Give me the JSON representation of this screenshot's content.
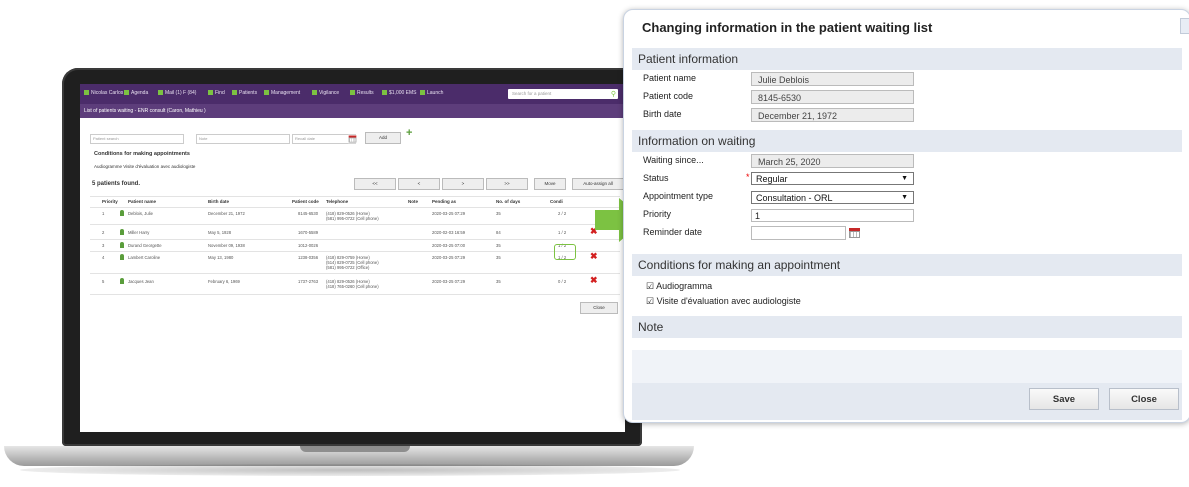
{
  "laptop": {
    "nav": [
      "Nicolas Carlos",
      "Agenda",
      "Mail (1) F (84)",
      "Find",
      "Patients",
      "Management",
      "Vigilance",
      "Results",
      "$1,000 EMS",
      "Launch"
    ],
    "search_placeholder": "Search for a patient",
    "subtitle": "List of patients waiting - ENR consult (Caron, Mathieu )",
    "filters": {
      "patient_search": "Patient search",
      "note": "Note",
      "recall_date": "Recall date",
      "add_label": "Add"
    },
    "conditions_title": "Conditions for making appointments",
    "condition_options": "Audiogramme  Visite d'évaluation avec audiologiste",
    "found_text": "5 patients found.",
    "pager": [
      "<<",
      "<",
      ">",
      ">>"
    ],
    "move_label": "Move",
    "auto_assign_label": "Auto-assign all",
    "close_label": "Close",
    "columns": [
      "Priority",
      "Patient name",
      "Birth date",
      "Patient code",
      "Telephone",
      "Note",
      "Pending as",
      "No. of days",
      "Condi"
    ],
    "rows": [
      {
        "priority": "1",
        "name": "Deblois, Julie",
        "birth": "December 21, 1972",
        "code": "8145-6530",
        "tel": "(418) 829-0526 (Home)\n(581) 995-0722 (Cell phone)",
        "pending": "2020-03-25 07:29",
        "days": "35",
        "cond": "2 / 2"
      },
      {
        "priority": "2",
        "name": "Miller Harry",
        "birth": "May 5, 1928",
        "code": "1670-5589",
        "tel": "",
        "pending": "2020-02-03 16:59",
        "days": "84",
        "cond": "1 / 2"
      },
      {
        "priority": "3",
        "name": "Durand Georgette",
        "birth": "November 09, 1938",
        "code": "1012-0026",
        "tel": "",
        "pending": "2020-03-25 07:00",
        "days": "35",
        "cond": "1 / 2"
      },
      {
        "priority": "4",
        "name": "Lambert Caroline",
        "birth": "May 13, 1980",
        "code": "1238-0356",
        "tel": "(418) 829-0759 (Home)\n(514) 829-0725 (Cell phone)\n(581) 995-0722 (Office)",
        "pending": "2020-03-25 07:29",
        "days": "35",
        "cond": "1 / 2"
      },
      {
        "priority": "5",
        "name": "Jacques Jean",
        "birth": "February 6, 1969",
        "code": "1737-2763",
        "tel": "(418) 829-0526 (Home)\n(418) 765-0260 (Cell phone)",
        "pending": "2020-03-25 07:29",
        "days": "35",
        "cond": "0 / 2"
      }
    ]
  },
  "dialog": {
    "title": "Changing information in the patient waiting list",
    "patient_info_title": "Patient information",
    "patient_name_label": "Patient name",
    "patient_name": "Julie Deblois",
    "patient_code_label": "Patient code",
    "patient_code": "8145-6530",
    "birth_date_label": "Birth date",
    "birth_date": "December 21, 1972",
    "waiting_title": "Information on waiting",
    "waiting_since_label": "Waiting since...",
    "waiting_since": "March 25, 2020",
    "status_label": "Status",
    "required_mark": "*",
    "status_value": "Regular",
    "appointment_type_label": "Appointment type",
    "appointment_type_value": "Consultation - ORL",
    "priority_label": "Priority",
    "priority_value": "1",
    "reminder_label": "Reminder date",
    "reminder_value": "",
    "conditions_title": "Conditions for making an appointment",
    "condition_1": "Audiogramma",
    "condition_2": "Visite d'évaluation avec audiologiste",
    "note_title": "Note",
    "save_label": "Save",
    "close_label": "Close"
  },
  "colors": {
    "topbar": "#4b2c6a",
    "accent_green": "#7cc242",
    "section_bg": "#e4e9f1",
    "delete_red": "#d32020"
  },
  "icons": [
    "person-icon",
    "delete-icon",
    "calendar-icon",
    "arrow-right-icon",
    "search-icon",
    "add-icon"
  ]
}
